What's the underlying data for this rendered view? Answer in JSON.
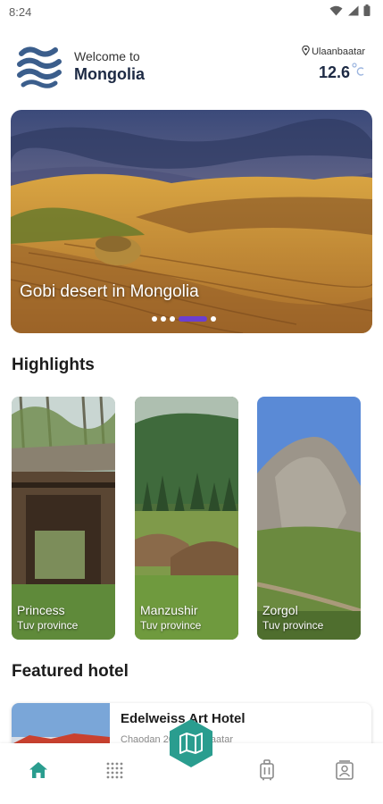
{
  "status_bar": {
    "time": "8:24",
    "icons": [
      "wifi-icon",
      "signal-icon",
      "battery-icon"
    ]
  },
  "header": {
    "greeting": "Welcome to",
    "country": "Mongolia",
    "logo_icon": "waves-logo",
    "location": "Ulaanbaatar",
    "location_icon": "location-pin-icon",
    "temperature": "12.6",
    "temperature_unit_icon": "celsius-icon"
  },
  "hero": {
    "caption": "Gobi desert in Mongolia",
    "slide_count": 5,
    "active_slide": 4
  },
  "highlights": {
    "title": "Highlights",
    "items": [
      {
        "name": "Princess",
        "province": "Tuv province"
      },
      {
        "name": "Manzushir",
        "province": "Tuv province"
      },
      {
        "name": "Zorgol",
        "province": "Tuv province"
      }
    ]
  },
  "featured_hotel": {
    "title": "Featured hotel",
    "name": "Edelweiss Art Hotel",
    "address": "Chaodan    20, Ulaanbaatar"
  },
  "bottom_nav": {
    "items": [
      "home-icon",
      "grid-icon",
      "map-icon",
      "luggage-icon",
      "profile-icon"
    ],
    "active": "home-icon"
  },
  "colors": {
    "accent": "#2a9d8f",
    "active_dot": "#6b3fd0",
    "title": "#1d2a44",
    "logo_blue": "#3b5e8c"
  }
}
